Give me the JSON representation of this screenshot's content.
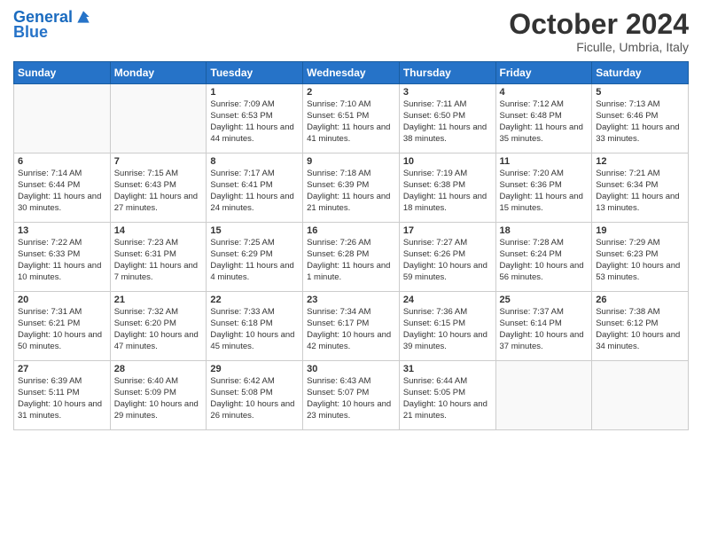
{
  "header": {
    "logo_line1": "General",
    "logo_line2": "Blue",
    "month": "October 2024",
    "location": "Ficulle, Umbria, Italy"
  },
  "columns": [
    "Sunday",
    "Monday",
    "Tuesday",
    "Wednesday",
    "Thursday",
    "Friday",
    "Saturday"
  ],
  "weeks": [
    [
      {
        "day": "",
        "info": "",
        "empty": true
      },
      {
        "day": "",
        "info": "",
        "empty": true
      },
      {
        "day": "1",
        "info": "Sunrise: 7:09 AM\nSunset: 6:53 PM\nDaylight: 11 hours and 44 minutes."
      },
      {
        "day": "2",
        "info": "Sunrise: 7:10 AM\nSunset: 6:51 PM\nDaylight: 11 hours and 41 minutes."
      },
      {
        "day": "3",
        "info": "Sunrise: 7:11 AM\nSunset: 6:50 PM\nDaylight: 11 hours and 38 minutes."
      },
      {
        "day": "4",
        "info": "Sunrise: 7:12 AM\nSunset: 6:48 PM\nDaylight: 11 hours and 35 minutes."
      },
      {
        "day": "5",
        "info": "Sunrise: 7:13 AM\nSunset: 6:46 PM\nDaylight: 11 hours and 33 minutes."
      }
    ],
    [
      {
        "day": "6",
        "info": "Sunrise: 7:14 AM\nSunset: 6:44 PM\nDaylight: 11 hours and 30 minutes."
      },
      {
        "day": "7",
        "info": "Sunrise: 7:15 AM\nSunset: 6:43 PM\nDaylight: 11 hours and 27 minutes."
      },
      {
        "day": "8",
        "info": "Sunrise: 7:17 AM\nSunset: 6:41 PM\nDaylight: 11 hours and 24 minutes."
      },
      {
        "day": "9",
        "info": "Sunrise: 7:18 AM\nSunset: 6:39 PM\nDaylight: 11 hours and 21 minutes."
      },
      {
        "day": "10",
        "info": "Sunrise: 7:19 AM\nSunset: 6:38 PM\nDaylight: 11 hours and 18 minutes."
      },
      {
        "day": "11",
        "info": "Sunrise: 7:20 AM\nSunset: 6:36 PM\nDaylight: 11 hours and 15 minutes."
      },
      {
        "day": "12",
        "info": "Sunrise: 7:21 AM\nSunset: 6:34 PM\nDaylight: 11 hours and 13 minutes."
      }
    ],
    [
      {
        "day": "13",
        "info": "Sunrise: 7:22 AM\nSunset: 6:33 PM\nDaylight: 11 hours and 10 minutes."
      },
      {
        "day": "14",
        "info": "Sunrise: 7:23 AM\nSunset: 6:31 PM\nDaylight: 11 hours and 7 minutes."
      },
      {
        "day": "15",
        "info": "Sunrise: 7:25 AM\nSunset: 6:29 PM\nDaylight: 11 hours and 4 minutes."
      },
      {
        "day": "16",
        "info": "Sunrise: 7:26 AM\nSunset: 6:28 PM\nDaylight: 11 hours and 1 minute."
      },
      {
        "day": "17",
        "info": "Sunrise: 7:27 AM\nSunset: 6:26 PM\nDaylight: 10 hours and 59 minutes."
      },
      {
        "day": "18",
        "info": "Sunrise: 7:28 AM\nSunset: 6:24 PM\nDaylight: 10 hours and 56 minutes."
      },
      {
        "day": "19",
        "info": "Sunrise: 7:29 AM\nSunset: 6:23 PM\nDaylight: 10 hours and 53 minutes."
      }
    ],
    [
      {
        "day": "20",
        "info": "Sunrise: 7:31 AM\nSunset: 6:21 PM\nDaylight: 10 hours and 50 minutes."
      },
      {
        "day": "21",
        "info": "Sunrise: 7:32 AM\nSunset: 6:20 PM\nDaylight: 10 hours and 47 minutes."
      },
      {
        "day": "22",
        "info": "Sunrise: 7:33 AM\nSunset: 6:18 PM\nDaylight: 10 hours and 45 minutes."
      },
      {
        "day": "23",
        "info": "Sunrise: 7:34 AM\nSunset: 6:17 PM\nDaylight: 10 hours and 42 minutes."
      },
      {
        "day": "24",
        "info": "Sunrise: 7:36 AM\nSunset: 6:15 PM\nDaylight: 10 hours and 39 minutes."
      },
      {
        "day": "25",
        "info": "Sunrise: 7:37 AM\nSunset: 6:14 PM\nDaylight: 10 hours and 37 minutes."
      },
      {
        "day": "26",
        "info": "Sunrise: 7:38 AM\nSunset: 6:12 PM\nDaylight: 10 hours and 34 minutes."
      }
    ],
    [
      {
        "day": "27",
        "info": "Sunrise: 6:39 AM\nSunset: 5:11 PM\nDaylight: 10 hours and 31 minutes."
      },
      {
        "day": "28",
        "info": "Sunrise: 6:40 AM\nSunset: 5:09 PM\nDaylight: 10 hours and 29 minutes."
      },
      {
        "day": "29",
        "info": "Sunrise: 6:42 AM\nSunset: 5:08 PM\nDaylight: 10 hours and 26 minutes."
      },
      {
        "day": "30",
        "info": "Sunrise: 6:43 AM\nSunset: 5:07 PM\nDaylight: 10 hours and 23 minutes."
      },
      {
        "day": "31",
        "info": "Sunrise: 6:44 AM\nSunset: 5:05 PM\nDaylight: 10 hours and 21 minutes."
      },
      {
        "day": "",
        "info": "",
        "empty": true
      },
      {
        "day": "",
        "info": "",
        "empty": true
      }
    ]
  ]
}
